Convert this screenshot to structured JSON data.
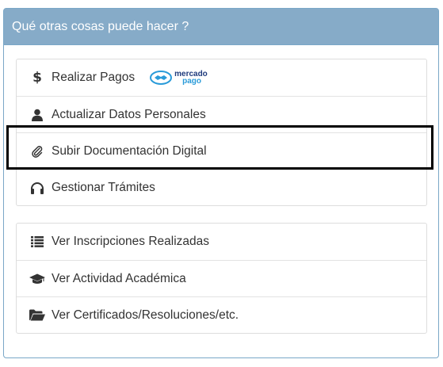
{
  "panel": {
    "title": "Qué otras cosas puede hacer ?"
  },
  "group1": [
    {
      "label": "Realizar Pagos",
      "icon": "dollar-icon",
      "symbol": "$"
    },
    {
      "label": "Actualizar Datos Personales",
      "icon": "user-icon"
    },
    {
      "label": "Subir Documentación Digital",
      "icon": "paperclip-icon"
    },
    {
      "label": "Gestionar Trámites",
      "icon": "headphones-icon"
    }
  ],
  "mercadopago": {
    "line1": "mercado",
    "line2": "pago"
  },
  "group2": [
    {
      "label": "Ver Inscripciones Realizadas",
      "icon": "list-icon"
    },
    {
      "label": "Ver Actividad Académica",
      "icon": "graduation-cap-icon"
    },
    {
      "label": "Ver Certificados/Resoluciones/etc.",
      "icon": "folder-open-icon"
    }
  ],
  "colors": {
    "header_bg": "#86abc8",
    "border": "#7aa7c7",
    "text": "#333333",
    "highlight": "#000000"
  }
}
